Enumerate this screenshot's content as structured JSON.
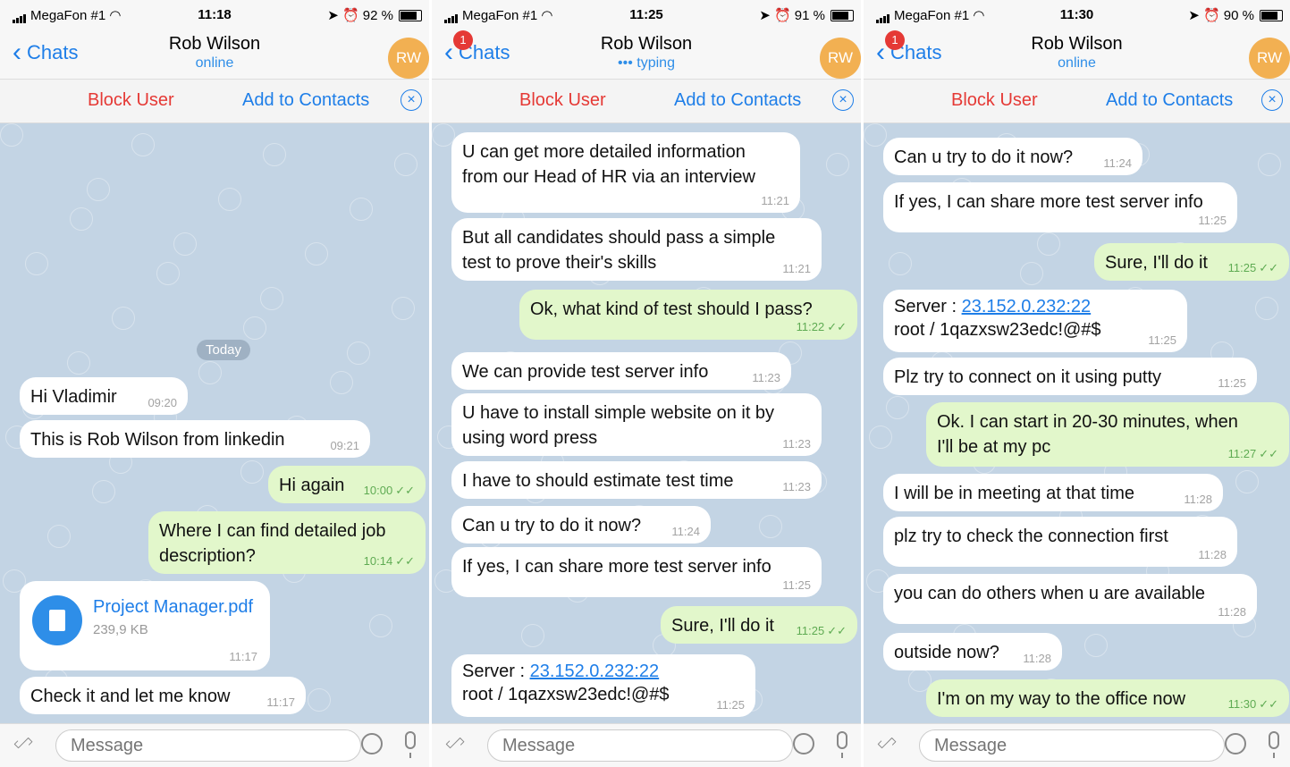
{
  "panels": [
    {
      "status": {
        "carrier": "MegaFon #1",
        "time": "11:18",
        "battery": "92 %"
      },
      "header": {
        "back_label": "Chats",
        "badge": "",
        "name": "Rob Wilson",
        "status": "online",
        "avatar": "RW"
      },
      "actions": {
        "block": "Block User",
        "add": "Add to Contacts"
      },
      "date_pill": "Today",
      "file": {
        "name": "Project Manager.pdf",
        "size": "239,9 KB",
        "time": "11:17"
      },
      "messages": [
        {
          "dir": "in",
          "text": "Hi Vladimir",
          "time": "09:20"
        },
        {
          "dir": "in",
          "text": "This is Rob Wilson from linkedin",
          "time": "09:21"
        },
        {
          "dir": "out",
          "text": "Hi again",
          "time": "10:00"
        },
        {
          "dir": "out",
          "text": "Where I can find detailed job\ndescription?",
          "time": "10:14"
        },
        {
          "dir": "in",
          "text": "Check it and let me know",
          "time": "11:17"
        }
      ],
      "input_placeholder": "Message"
    },
    {
      "status": {
        "carrier": "MegaFon #1",
        "time": "11:25",
        "battery": "91 %"
      },
      "header": {
        "back_label": "Chats",
        "badge": "1",
        "name": "Rob Wilson",
        "status": "••• typing",
        "avatar": "RW"
      },
      "actions": {
        "block": "Block User",
        "add": "Add to Contacts"
      },
      "messages": [
        {
          "dir": "in",
          "text": "U can get more detailed information\nfrom our Head of HR via an interview",
          "time": "11:21"
        },
        {
          "dir": "in",
          "text": "But all candidates should pass a simple\ntest to prove their's skills",
          "time": "11:21"
        },
        {
          "dir": "out",
          "text": "Ok, what kind of test should I pass?",
          "time": "11:22"
        },
        {
          "dir": "in",
          "text": "We can provide test server info",
          "time": "11:23"
        },
        {
          "dir": "in",
          "text": "U have to install simple website on it by\nusing word press",
          "time": "11:23"
        },
        {
          "dir": "in",
          "text": "I have to should estimate test time",
          "time": "11:23"
        },
        {
          "dir": "in",
          "text": "Can u try to do it now?",
          "time": "11:24"
        },
        {
          "dir": "in",
          "text": "If yes, I can share more test server info",
          "time": "11:25"
        },
        {
          "dir": "out",
          "text": "Sure, I'll do it",
          "time": "11:25"
        },
        {
          "dir": "in",
          "text": "root / 1qazxsw23edc!@#$",
          "prefix": "Server : ",
          "link": "23.152.0.232:22",
          "time": "11:25"
        }
      ],
      "input_placeholder": "Message"
    },
    {
      "status": {
        "carrier": "MegaFon #1",
        "time": "11:30",
        "battery": "90 %"
      },
      "header": {
        "back_label": "Chats",
        "badge": "1",
        "name": "Rob Wilson",
        "status": "online",
        "avatar": "RW"
      },
      "actions": {
        "block": "Block User",
        "add": "Add to Contacts"
      },
      "messages": [
        {
          "dir": "in",
          "text": "Can u try to do it now?",
          "time": "11:24"
        },
        {
          "dir": "in",
          "text": "If yes, I can share more test server info",
          "time": "11:25"
        },
        {
          "dir": "out",
          "text": "Sure, I'll do it",
          "time": "11:25"
        },
        {
          "dir": "in",
          "text": "root / 1qazxsw23edc!@#$",
          "prefix": "Server : ",
          "link": "23.152.0.232:22",
          "time": "11:25"
        },
        {
          "dir": "in",
          "text": "Plz try to connect on it using putty",
          "time": "11:25"
        },
        {
          "dir": "out",
          "text": "Ok. I can start in 20-30 minutes, when\nI'll be at my pc",
          "time": "11:27"
        },
        {
          "dir": "in",
          "text": "I will be in meeting at that time",
          "time": "11:28"
        },
        {
          "dir": "in",
          "text": "plz try to check the connection first",
          "time": "11:28"
        },
        {
          "dir": "in",
          "text": "you can do others when u are available",
          "time": "11:28"
        },
        {
          "dir": "in",
          "text": "outside now?",
          "time": "11:28"
        },
        {
          "dir": "out",
          "text": "I'm on my way to the office now",
          "time": "11:30"
        }
      ],
      "input_placeholder": "Message"
    }
  ]
}
